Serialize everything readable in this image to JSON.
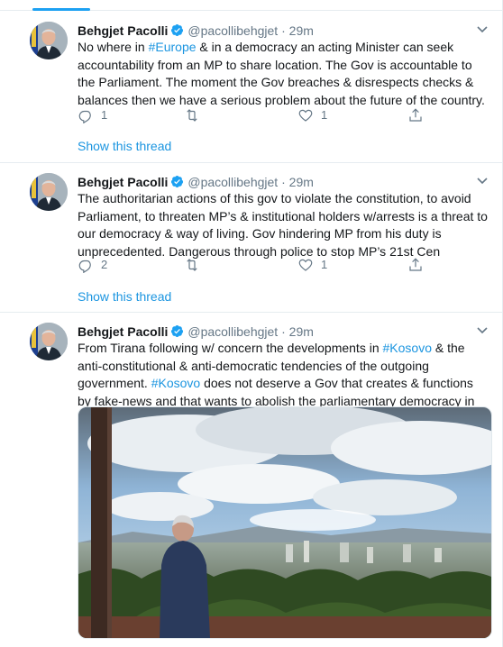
{
  "tweets": [
    {
      "author": "Behgjet Pacolli",
      "handle": "@pacollibehgjet",
      "separator": "·",
      "time": "29m",
      "text_parts": [
        "No where in ",
        "#Europe",
        " & in a democracy an acting Minister can seek accountability from an MP to share location. The Gov is accountable to the Parliament. The moment the Gov breaches & disrespects checks & balances then we have a serious problem about the future of the country."
      ],
      "replies": "1",
      "retweets": "",
      "likes": "1",
      "show_thread": "Show this thread"
    },
    {
      "author": "Behgjet Pacolli",
      "handle": "@pacollibehgjet",
      "separator": "·",
      "time": "29m",
      "text": "The authoritarian actions of this gov to violate the constitution, to avoid Parliament, to threaten MP’s & institutional holders w/arrests is a threat to our democracy & way of living. Gov hindering MP from his duty is unprecedented. Dangerous through police to stop MP’s 21st Cen",
      "replies": "2",
      "retweets": "",
      "likes": "1",
      "show_thread": "Show this thread"
    },
    {
      "author": "Behgjet Pacolli",
      "handle": "@pacollibehgjet",
      "separator": "·",
      "time": "29m",
      "text_parts": [
        "From Tirana following w/ concern the developments in ",
        "#Kosovo",
        " & the anti-constitutional & anti-democratic tendencies of the outgoing government. ",
        "#Kosovo",
        " does not deserve a Gov that creates & functions by fake-news and that wants to abolish the parliamentary democracy in Kosovo"
      ]
    }
  ],
  "colors": {
    "link": "#1b95e0",
    "secondary_text": "#657786",
    "border": "#e6ecf0"
  },
  "icons": [
    "verified-badge-icon",
    "caret-down-icon",
    "reply-icon",
    "retweet-icon",
    "like-icon",
    "share-icon"
  ]
}
